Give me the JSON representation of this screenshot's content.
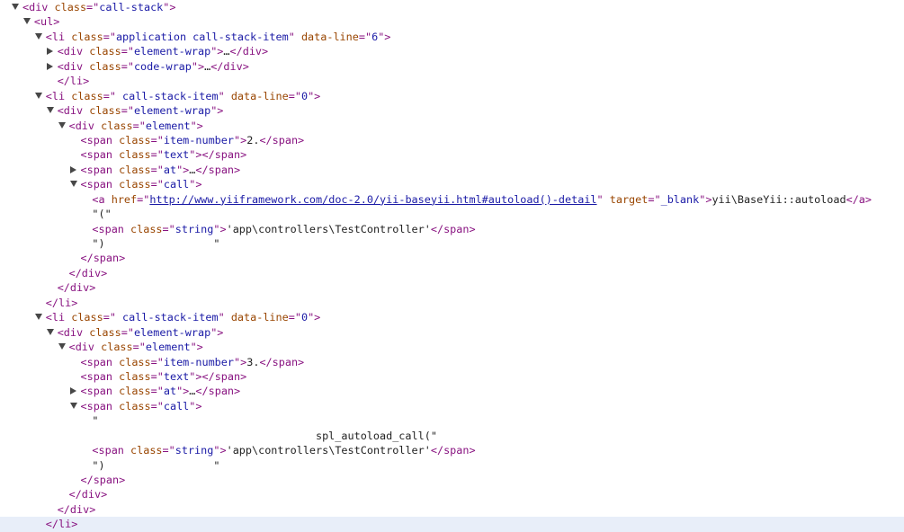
{
  "panel": "elements",
  "colors": {
    "tag": "#881280",
    "attribute_name": "#994500",
    "attribute_value": "#1a1aa6",
    "text": "#222222",
    "disclosure_triangle": "#474747",
    "highlighted_row": "#e8eef9"
  },
  "rows": [
    {
      "disclosure": "expanded",
      "indent": 0,
      "highlighted": false,
      "segments": [
        {
          "type": "tag",
          "text": "<div"
        },
        {
          "type": "txt",
          "text": " "
        },
        {
          "type": "attr",
          "text": "class"
        },
        {
          "type": "tag",
          "text": "=\""
        },
        {
          "type": "val",
          "text": "call-stack"
        },
        {
          "type": "tag",
          "text": "\">"
        }
      ]
    },
    {
      "disclosure": "expanded",
      "indent": 1,
      "highlighted": false,
      "segments": [
        {
          "type": "tag",
          "text": "<ul>"
        }
      ]
    },
    {
      "disclosure": "expanded",
      "indent": 2,
      "highlighted": false,
      "segments": [
        {
          "type": "tag",
          "text": "<li"
        },
        {
          "type": "txt",
          "text": " "
        },
        {
          "type": "attr",
          "text": "class"
        },
        {
          "type": "tag",
          "text": "=\""
        },
        {
          "type": "val",
          "text": "application call-stack-item"
        },
        {
          "type": "tag",
          "text": "\""
        },
        {
          "type": "txt",
          "text": " "
        },
        {
          "type": "attr",
          "text": "data-line"
        },
        {
          "type": "tag",
          "text": "=\""
        },
        {
          "type": "val",
          "text": "6"
        },
        {
          "type": "tag",
          "text": "\">"
        }
      ]
    },
    {
      "disclosure": "collapsed",
      "indent": 3,
      "highlighted": false,
      "segments": [
        {
          "type": "tag",
          "text": "<div"
        },
        {
          "type": "txt",
          "text": " "
        },
        {
          "type": "attr",
          "text": "class"
        },
        {
          "type": "tag",
          "text": "=\""
        },
        {
          "type": "val",
          "text": "element-wrap"
        },
        {
          "type": "tag",
          "text": "\">"
        },
        {
          "type": "txt",
          "text": "…"
        },
        {
          "type": "tag",
          "text": "</div>"
        }
      ]
    },
    {
      "disclosure": "collapsed",
      "indent": 3,
      "highlighted": false,
      "segments": [
        {
          "type": "tag",
          "text": "<div"
        },
        {
          "type": "txt",
          "text": " "
        },
        {
          "type": "attr",
          "text": "class"
        },
        {
          "type": "tag",
          "text": "=\""
        },
        {
          "type": "val",
          "text": "code-wrap"
        },
        {
          "type": "tag",
          "text": "\">"
        },
        {
          "type": "txt",
          "text": "…"
        },
        {
          "type": "tag",
          "text": "</div>"
        }
      ]
    },
    {
      "disclosure": "none",
      "indent": 3,
      "highlighted": false,
      "segments": [
        {
          "type": "tag",
          "text": "</li>"
        }
      ]
    },
    {
      "disclosure": "expanded",
      "indent": 2,
      "highlighted": false,
      "segments": [
        {
          "type": "tag",
          "text": "<li"
        },
        {
          "type": "txt",
          "text": " "
        },
        {
          "type": "attr",
          "text": "class"
        },
        {
          "type": "tag",
          "text": "=\""
        },
        {
          "type": "val",
          "text": " call-stack-item"
        },
        {
          "type": "tag",
          "text": "\""
        },
        {
          "type": "txt",
          "text": " "
        },
        {
          "type": "attr",
          "text": "data-line"
        },
        {
          "type": "tag",
          "text": "=\""
        },
        {
          "type": "val",
          "text": "0"
        },
        {
          "type": "tag",
          "text": "\">"
        }
      ]
    },
    {
      "disclosure": "expanded",
      "indent": 3,
      "highlighted": false,
      "segments": [
        {
          "type": "tag",
          "text": "<div"
        },
        {
          "type": "txt",
          "text": " "
        },
        {
          "type": "attr",
          "text": "class"
        },
        {
          "type": "tag",
          "text": "=\""
        },
        {
          "type": "val",
          "text": "element-wrap"
        },
        {
          "type": "tag",
          "text": "\">"
        }
      ]
    },
    {
      "disclosure": "expanded",
      "indent": 4,
      "highlighted": false,
      "segments": [
        {
          "type": "tag",
          "text": "<div"
        },
        {
          "type": "txt",
          "text": " "
        },
        {
          "type": "attr",
          "text": "class"
        },
        {
          "type": "tag",
          "text": "=\""
        },
        {
          "type": "val",
          "text": "element"
        },
        {
          "type": "tag",
          "text": "\">"
        }
      ]
    },
    {
      "disclosure": "none",
      "indent": 5,
      "highlighted": false,
      "segments": [
        {
          "type": "tag",
          "text": "<span"
        },
        {
          "type": "txt",
          "text": " "
        },
        {
          "type": "attr",
          "text": "class"
        },
        {
          "type": "tag",
          "text": "=\""
        },
        {
          "type": "val",
          "text": "item-number"
        },
        {
          "type": "tag",
          "text": "\">"
        },
        {
          "type": "txt",
          "text": "2."
        },
        {
          "type": "tag",
          "text": "</span>"
        }
      ]
    },
    {
      "disclosure": "none",
      "indent": 5,
      "highlighted": false,
      "segments": [
        {
          "type": "tag",
          "text": "<span"
        },
        {
          "type": "txt",
          "text": " "
        },
        {
          "type": "attr",
          "text": "class"
        },
        {
          "type": "tag",
          "text": "=\""
        },
        {
          "type": "val",
          "text": "text"
        },
        {
          "type": "tag",
          "text": "\">"
        },
        {
          "type": "tag",
          "text": "</span>"
        }
      ]
    },
    {
      "disclosure": "collapsed",
      "indent": 5,
      "highlighted": false,
      "segments": [
        {
          "type": "tag",
          "text": "<span"
        },
        {
          "type": "txt",
          "text": " "
        },
        {
          "type": "attr",
          "text": "class"
        },
        {
          "type": "tag",
          "text": "=\""
        },
        {
          "type": "val",
          "text": "at"
        },
        {
          "type": "tag",
          "text": "\">"
        },
        {
          "type": "txt",
          "text": "…"
        },
        {
          "type": "tag",
          "text": "</span>"
        }
      ]
    },
    {
      "disclosure": "expanded",
      "indent": 5,
      "highlighted": false,
      "segments": [
        {
          "type": "tag",
          "text": "<span"
        },
        {
          "type": "txt",
          "text": " "
        },
        {
          "type": "attr",
          "text": "class"
        },
        {
          "type": "tag",
          "text": "=\""
        },
        {
          "type": "val",
          "text": "call"
        },
        {
          "type": "tag",
          "text": "\">"
        }
      ]
    },
    {
      "disclosure": "none",
      "indent": 6,
      "highlighted": false,
      "segments": [
        {
          "type": "tag",
          "text": "<a"
        },
        {
          "type": "txt",
          "text": " "
        },
        {
          "type": "attr",
          "text": "href"
        },
        {
          "type": "tag",
          "text": "=\""
        },
        {
          "type": "link",
          "text": "http://www.yiiframework.com/doc-2.0/yii-baseyii.html#autoload()-detail"
        },
        {
          "type": "tag",
          "text": "\""
        },
        {
          "type": "txt",
          "text": " "
        },
        {
          "type": "attr",
          "text": "target"
        },
        {
          "type": "tag",
          "text": "=\""
        },
        {
          "type": "val",
          "text": "_blank"
        },
        {
          "type": "tag",
          "text": "\">"
        },
        {
          "type": "txt",
          "text": "yii\\BaseYii::autoload"
        },
        {
          "type": "tag",
          "text": "</a>"
        }
      ]
    },
    {
      "disclosure": "none",
      "indent": 6,
      "highlighted": false,
      "segments": [
        {
          "type": "txt",
          "text": "\"(\""
        }
      ]
    },
    {
      "disclosure": "none",
      "indent": 6,
      "highlighted": false,
      "segments": [
        {
          "type": "tag",
          "text": "<span"
        },
        {
          "type": "txt",
          "text": " "
        },
        {
          "type": "attr",
          "text": "class"
        },
        {
          "type": "tag",
          "text": "=\""
        },
        {
          "type": "val",
          "text": "string"
        },
        {
          "type": "tag",
          "text": "\">"
        },
        {
          "type": "txt",
          "text": "'app\\controllers\\TestController'"
        },
        {
          "type": "tag",
          "text": "</span>"
        }
      ]
    },
    {
      "disclosure": "none",
      "indent": 6,
      "highlighted": false,
      "segments": [
        {
          "type": "txt",
          "text": "\")                 \""
        }
      ]
    },
    {
      "disclosure": "none",
      "indent": 5,
      "highlighted": false,
      "segments": [
        {
          "type": "tag",
          "text": "</span>"
        }
      ]
    },
    {
      "disclosure": "none",
      "indent": 4,
      "highlighted": false,
      "segments": [
        {
          "type": "tag",
          "text": "</div>"
        }
      ]
    },
    {
      "disclosure": "none",
      "indent": 3,
      "highlighted": false,
      "segments": [
        {
          "type": "tag",
          "text": "</div>"
        }
      ]
    },
    {
      "disclosure": "none",
      "indent": 2,
      "highlighted": false,
      "segments": [
        {
          "type": "tag",
          "text": "</li>"
        }
      ]
    },
    {
      "disclosure": "expanded",
      "indent": 2,
      "highlighted": false,
      "segments": [
        {
          "type": "tag",
          "text": "<li"
        },
        {
          "type": "txt",
          "text": " "
        },
        {
          "type": "attr",
          "text": "class"
        },
        {
          "type": "tag",
          "text": "=\""
        },
        {
          "type": "val",
          "text": " call-stack-item"
        },
        {
          "type": "tag",
          "text": "\""
        },
        {
          "type": "txt",
          "text": " "
        },
        {
          "type": "attr",
          "text": "data-line"
        },
        {
          "type": "tag",
          "text": "=\""
        },
        {
          "type": "val",
          "text": "0"
        },
        {
          "type": "tag",
          "text": "\">"
        }
      ]
    },
    {
      "disclosure": "expanded",
      "indent": 3,
      "highlighted": false,
      "segments": [
        {
          "type": "tag",
          "text": "<div"
        },
        {
          "type": "txt",
          "text": " "
        },
        {
          "type": "attr",
          "text": "class"
        },
        {
          "type": "tag",
          "text": "=\""
        },
        {
          "type": "val",
          "text": "element-wrap"
        },
        {
          "type": "tag",
          "text": "\">"
        }
      ]
    },
    {
      "disclosure": "expanded",
      "indent": 4,
      "highlighted": false,
      "segments": [
        {
          "type": "tag",
          "text": "<div"
        },
        {
          "type": "txt",
          "text": " "
        },
        {
          "type": "attr",
          "text": "class"
        },
        {
          "type": "tag",
          "text": "=\""
        },
        {
          "type": "val",
          "text": "element"
        },
        {
          "type": "tag",
          "text": "\">"
        }
      ]
    },
    {
      "disclosure": "none",
      "indent": 5,
      "highlighted": false,
      "segments": [
        {
          "type": "tag",
          "text": "<span"
        },
        {
          "type": "txt",
          "text": " "
        },
        {
          "type": "attr",
          "text": "class"
        },
        {
          "type": "tag",
          "text": "=\""
        },
        {
          "type": "val",
          "text": "item-number"
        },
        {
          "type": "tag",
          "text": "\">"
        },
        {
          "type": "txt",
          "text": "3."
        },
        {
          "type": "tag",
          "text": "</span>"
        }
      ]
    },
    {
      "disclosure": "none",
      "indent": 5,
      "highlighted": false,
      "segments": [
        {
          "type": "tag",
          "text": "<span"
        },
        {
          "type": "txt",
          "text": " "
        },
        {
          "type": "attr",
          "text": "class"
        },
        {
          "type": "tag",
          "text": "=\""
        },
        {
          "type": "val",
          "text": "text"
        },
        {
          "type": "tag",
          "text": "\">"
        },
        {
          "type": "tag",
          "text": "</span>"
        }
      ]
    },
    {
      "disclosure": "collapsed",
      "indent": 5,
      "highlighted": false,
      "segments": [
        {
          "type": "tag",
          "text": "<span"
        },
        {
          "type": "txt",
          "text": " "
        },
        {
          "type": "attr",
          "text": "class"
        },
        {
          "type": "tag",
          "text": "=\""
        },
        {
          "type": "val",
          "text": "at"
        },
        {
          "type": "tag",
          "text": "\">"
        },
        {
          "type": "txt",
          "text": "…"
        },
        {
          "type": "tag",
          "text": "</span>"
        }
      ]
    },
    {
      "disclosure": "expanded",
      "indent": 5,
      "highlighted": false,
      "segments": [
        {
          "type": "tag",
          "text": "<span"
        },
        {
          "type": "txt",
          "text": " "
        },
        {
          "type": "attr",
          "text": "class"
        },
        {
          "type": "tag",
          "text": "=\""
        },
        {
          "type": "val",
          "text": "call"
        },
        {
          "type": "tag",
          "text": "\">"
        }
      ]
    },
    {
      "disclosure": "none",
      "indent": 6,
      "highlighted": false,
      "segments": [
        {
          "type": "txt",
          "text": "\""
        }
      ]
    },
    {
      "disclosure": "none",
      "indent": 6,
      "highlighted": false,
      "segments": [
        {
          "type": "txt",
          "text": "                                   spl_autoload_call(\""
        }
      ]
    },
    {
      "disclosure": "none",
      "indent": 6,
      "highlighted": false,
      "segments": [
        {
          "type": "tag",
          "text": "<span"
        },
        {
          "type": "txt",
          "text": " "
        },
        {
          "type": "attr",
          "text": "class"
        },
        {
          "type": "tag",
          "text": "=\""
        },
        {
          "type": "val",
          "text": "string"
        },
        {
          "type": "tag",
          "text": "\">"
        },
        {
          "type": "txt",
          "text": "'app\\controllers\\TestController'"
        },
        {
          "type": "tag",
          "text": "</span>"
        }
      ]
    },
    {
      "disclosure": "none",
      "indent": 6,
      "highlighted": false,
      "segments": [
        {
          "type": "txt",
          "text": "\")                 \""
        }
      ]
    },
    {
      "disclosure": "none",
      "indent": 5,
      "highlighted": false,
      "segments": [
        {
          "type": "tag",
          "text": "</span>"
        }
      ]
    },
    {
      "disclosure": "none",
      "indent": 4,
      "highlighted": false,
      "segments": [
        {
          "type": "tag",
          "text": "</div>"
        }
      ]
    },
    {
      "disclosure": "none",
      "indent": 3,
      "highlighted": false,
      "segments": [
        {
          "type": "tag",
          "text": "</div>"
        }
      ]
    },
    {
      "disclosure": "none",
      "indent": 2,
      "highlighted": true,
      "segments": [
        {
          "type": "tag",
          "text": "</li>"
        }
      ]
    }
  ]
}
